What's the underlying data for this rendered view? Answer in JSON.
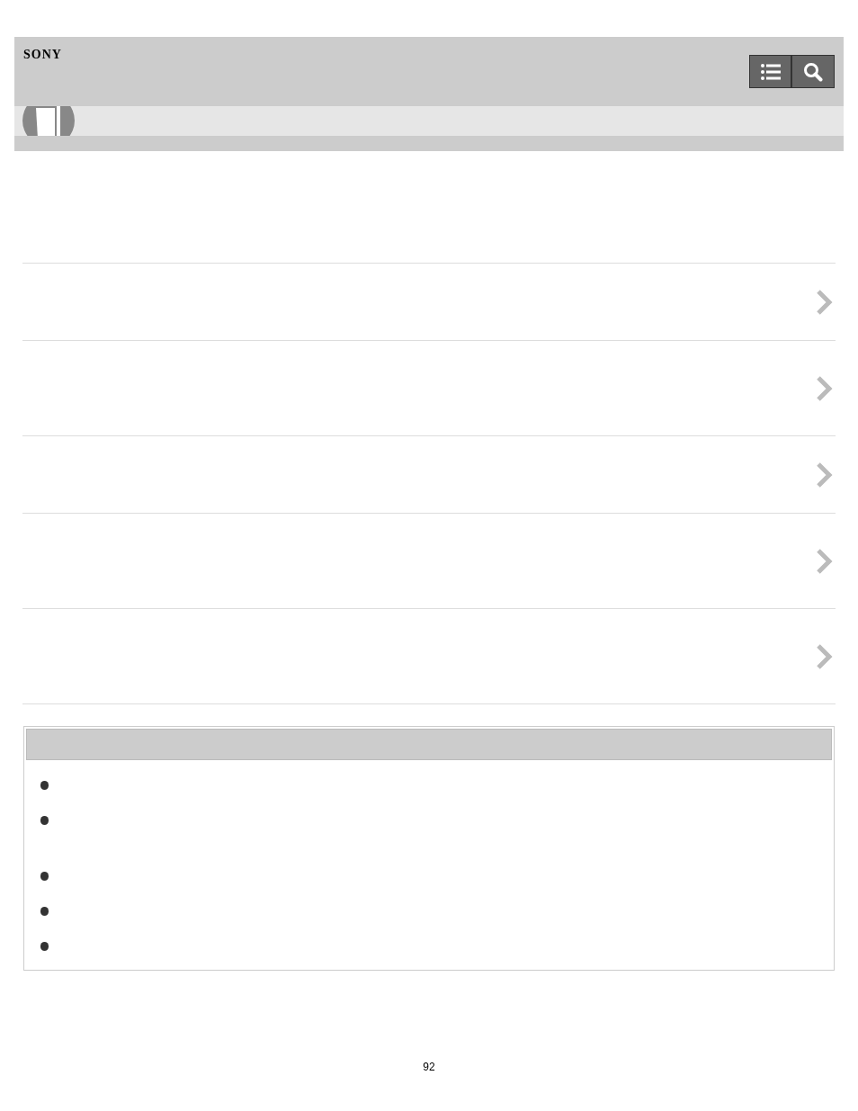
{
  "header": {
    "logo": "SONY"
  },
  "link_rows": [
    {
      "kind": "short"
    },
    {
      "kind": "tall"
    },
    {
      "kind": "short"
    },
    {
      "kind": "tall"
    },
    {
      "kind": "tall"
    }
  ],
  "related_box": {
    "bullets": [
      {
        "kind": "single"
      },
      {
        "kind": "double"
      },
      {
        "kind": "single"
      },
      {
        "kind": "single"
      },
      {
        "kind": "single"
      }
    ]
  },
  "page_number": "92"
}
